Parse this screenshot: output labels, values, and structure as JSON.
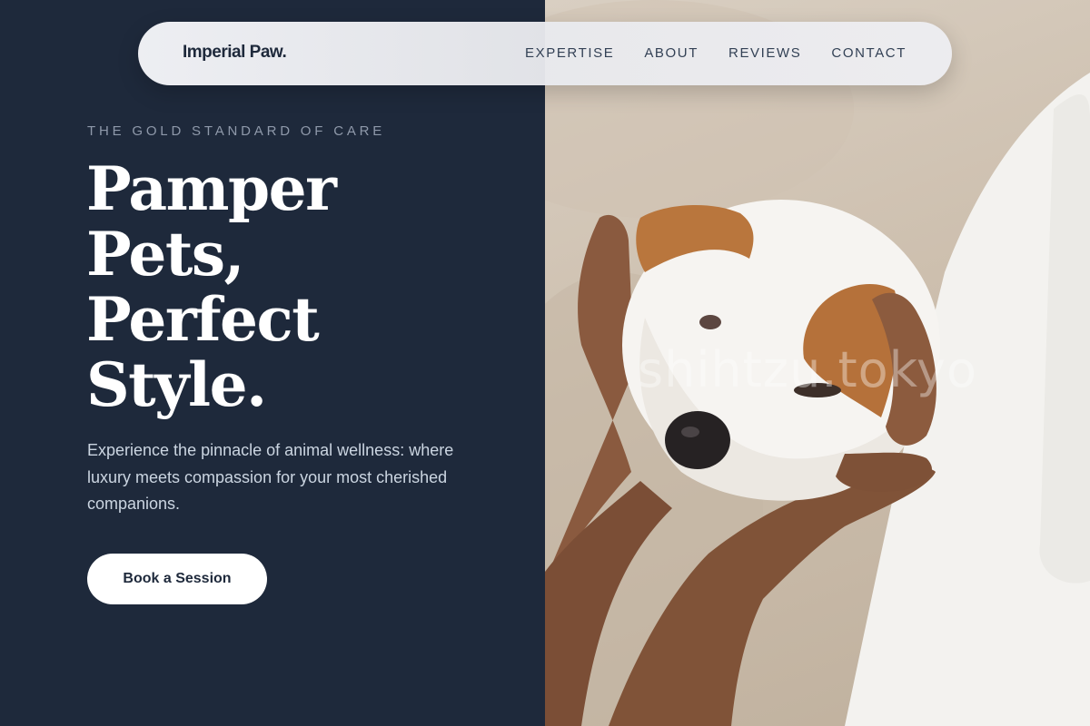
{
  "brand": "Imperial Paw.",
  "nav": [
    {
      "label": "EXPERTISE"
    },
    {
      "label": "ABOUT"
    },
    {
      "label": "REVIEWS"
    },
    {
      "label": "CONTACT"
    }
  ],
  "hero": {
    "eyebrow": "THE GOLD STANDARD OF CARE",
    "headline_lines": [
      "Pamper",
      "Pets,",
      "Perfect",
      "Style."
    ],
    "subtext": "Experience the pinnacle of animal wellness: where luxury meets compassion for your most cherished companions.",
    "cta_label": "Book a Session"
  },
  "image": {
    "watermark": "shihtzu.tokyo"
  },
  "colors": {
    "primary_dark": "#1e293b",
    "text_light": "#cbd5e1",
    "eyebrow": "#8f99aa",
    "button_bg": "#ffffff"
  }
}
